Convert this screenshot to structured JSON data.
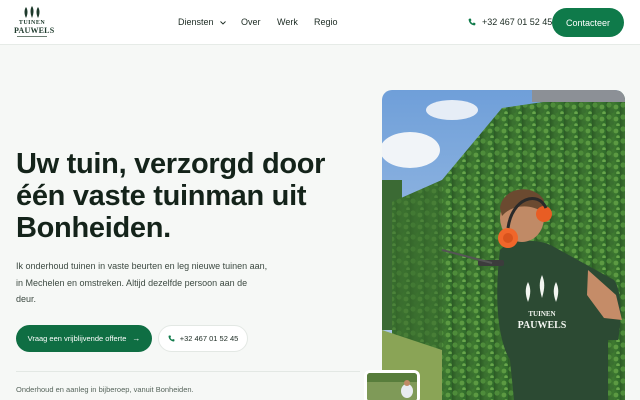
{
  "brand": {
    "logo_line1": "TUINEN",
    "logo_line2": "PAUWELS"
  },
  "nav": {
    "items": [
      {
        "label": "Diensten",
        "has_dropdown": true
      },
      {
        "label": "Over"
      },
      {
        "label": "Werk"
      },
      {
        "label": "Regio"
      }
    ]
  },
  "header": {
    "phone": "+32 467 01 52 45",
    "contact_label": "Contacteer"
  },
  "hero": {
    "title": "Uw tuin, verzorgd door één vaste tuinman uit Bonheiden.",
    "description": "Ik onderhoud tuinen in vaste beurten en leg nieuwe tuinen aan, in Mechelen en omstreken. Altijd dezelfde persoon aan de deur.",
    "cta_primary": "Vraag een vrijblijvende offerte",
    "cta_phone": "+32 467 01 52 45",
    "tagline": "Onderhoud en aanleg in bijberoep, vanuit Bonheiden."
  },
  "photo": {
    "shirt_line1": "TUINEN",
    "shirt_line2": "PAUWELS"
  },
  "colors": {
    "accent": "#0f7a4a",
    "background": "#f6f8f6",
    "text": "#14231a"
  },
  "icons": {
    "phone": "phone-icon",
    "arrow": "arrow-right-icon",
    "chevron": "chevron-down-icon",
    "logo": "leaf-logo-icon"
  }
}
